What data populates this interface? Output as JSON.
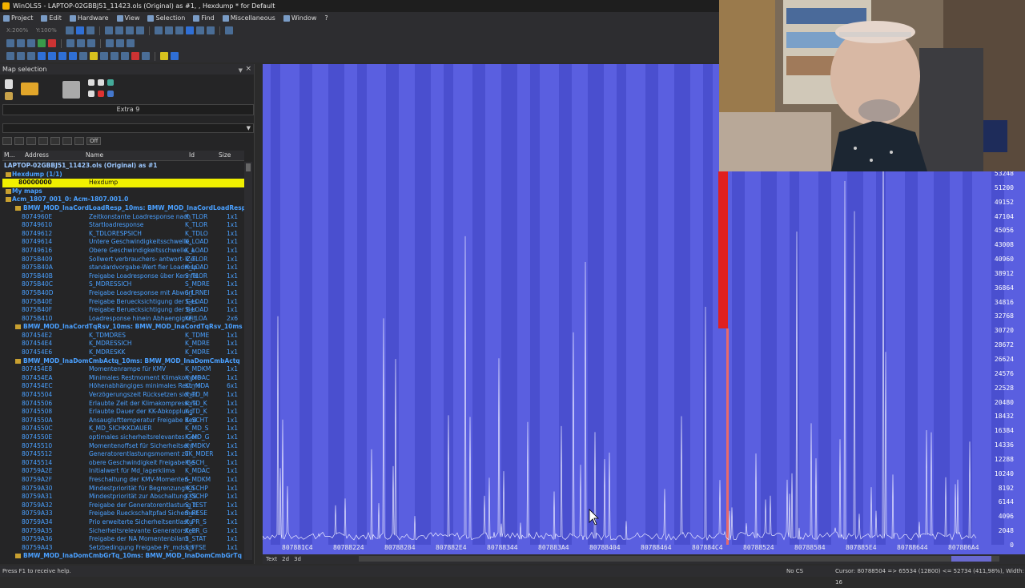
{
  "window": {
    "title": "WinOLS5 - LAPTOP-02GBBJ51_11423.ols (Original) as #1, , Hexdump * for Default"
  },
  "menu": [
    "Project",
    "Edit",
    "Hardware",
    "View",
    "Selection",
    "Find",
    "Miscellaneous",
    "Window",
    "?"
  ],
  "toolbar": {
    "zoom_x": "X:200%",
    "zoom_y": "Y:100%"
  },
  "map_selection": {
    "title": "Map selection",
    "extra_label": "Extra 9",
    "filter_off": "Off",
    "columns": [
      "M...",
      "Address",
      "Name",
      "Id",
      "Size"
    ],
    "project_row": "LAPTOP-02GBBJ51_11423.ols (Original) as #1",
    "hexdump_group": "Hexdump (1/1)",
    "hexdump_entry": {
      "address": "80000000",
      "name": "Hexdump"
    },
    "my_maps": "My maps",
    "acm_group": "Acm_1807_001_0: Acm-1807.001.0",
    "groups": [
      {
        "label": "BMW_MOD_InaCordLoadResp_10ms: BMW_MOD_InaCordLoadResp",
        "rows": [
          {
            "address": "8074960E",
            "name": "Zeitkonstante Loadresponse nach",
            "id": "K_TLOR",
            "size": "1x1"
          },
          {
            "address": "80749610",
            "name": "Startloadresponse",
            "id": "K_TLOR",
            "size": "1x1"
          },
          {
            "address": "80749612",
            "name": "K_TDLORESPSICH",
            "id": "K_TDLO",
            "size": "1x1"
          },
          {
            "address": "80749614",
            "name": "Untere Geschwindigkeitsschwelle,",
            "id": "K_LOAD",
            "size": "1x1"
          },
          {
            "address": "80749616",
            "name": "Obere Geschwindigkeitsschwelle, a",
            "id": "K_LOAD",
            "size": "1x1"
          },
          {
            "address": "8075B409",
            "name": "Sollwert verbrauchers- antwort- Zei",
            "id": "K_TLOR",
            "size": "1x1"
          },
          {
            "address": "8075B40A",
            "name": "standardvorgabe-Wert fier Loadresp",
            "id": "K_LOAD",
            "size": "1x1"
          },
          {
            "address": "8075B40B",
            "name": "Freigabe Loadresponse über Kennfel",
            "id": "S_TLOR",
            "size": "1x1"
          },
          {
            "address": "8075B40C",
            "name": "S_MDRESSICH",
            "id": "S_MDRE",
            "size": "1x1"
          },
          {
            "address": "8075B40D",
            "name": "Freigabe Loadresponse mit Abwurf",
            "id": "S_LRNEI",
            "size": "1x1"
          },
          {
            "address": "8075B40E",
            "name": "Freigabe Beruecksichtigung der Ges",
            "id": "S_LOAD",
            "size": "1x1"
          },
          {
            "address": "8075B40F",
            "name": "Freigabe Beruecksichtigung der Ber",
            "id": "S_LOAD",
            "size": "1x1"
          },
          {
            "address": "8075B410",
            "name": "Loadresponse hinein Abhaengigkeit",
            "id": "KF_LOA",
            "size": "2x6"
          }
        ]
      },
      {
        "label": "BMW_MOD_InaCordTqRsv_10ms: BMW_MOD_InaCordTqRsv_10ms",
        "rows": [
          {
            "address": "807454E2",
            "name": "K_TDMDRES",
            "id": "K_TDME",
            "size": "1x1"
          },
          {
            "address": "807454E4",
            "name": "K_MDRESSICH",
            "id": "K_MDRE",
            "size": "1x1"
          },
          {
            "address": "807454E6",
            "name": "K_MDRESKK",
            "id": "K_MDRE",
            "size": "1x1"
          }
        ]
      },
      {
        "label": "BMW_MOD_InaDomCmbActq_10ms: BMW_MOD_InaDomCmbActq",
        "rows": [
          {
            "address": "807454E8",
            "name": "Momentenrampe für KMV",
            "id": "K_MDKM",
            "size": "1x1"
          },
          {
            "address": "807454EA",
            "name": "Minimales Restmoment Klimakompre",
            "id": "K_MDAC",
            "size": "1x1"
          },
          {
            "address": "807454EC",
            "name": "Höhenabhängiges minimales Restmo",
            "id": "KL_MDA",
            "size": "6x1"
          },
          {
            "address": "80745504",
            "name": "Verzögerungszeit Rücksetzen sicher",
            "id": "K_TD_M",
            "size": "1x1"
          },
          {
            "address": "80745506",
            "name": "Erlaubte Zeit der Klimakompressora",
            "id": "K_TD_K",
            "size": "1x1"
          },
          {
            "address": "80745508",
            "name": "Erlaubte Dauer der KK-Abkopplung",
            "id": "K_TD_K",
            "size": "1x1"
          },
          {
            "address": "8074550A",
            "name": "Ansauglufttemperatur Freigabe Bed",
            "id": "K_SCHT",
            "size": "1x1"
          },
          {
            "address": "8074550C",
            "name": "K_MD_SICHKKDAUER",
            "id": "K_MD_S",
            "size": "1x1"
          },
          {
            "address": "8074550E",
            "name": "optimales sicherheitsrelevantes Gen",
            "id": "K_MD_G",
            "size": "1x1"
          },
          {
            "address": "80745510",
            "name": "Momentenoffset für Sicherheitsent",
            "id": "K_MDKV",
            "size": "1x1"
          },
          {
            "address": "80745512",
            "name": "Generatorentlastungsmoment zu",
            "id": "TK_MDER",
            "size": "1x1"
          },
          {
            "address": "80745514",
            "name": "obere Geschwindigkeit Freigabe Be",
            "id": "K_SCH_",
            "size": "1x1"
          },
          {
            "address": "80759A2E",
            "name": "Initialwert für Md_lagerklima",
            "id": "K_MDAC",
            "size": "1x1"
          },
          {
            "address": "80759A2F",
            "name": "Freschaltung der KMV-Momenten-",
            "id": "S_MDKM",
            "size": "1x1"
          },
          {
            "address": "80759A30",
            "name": "Mindestpriorität für Begrenzung Kli",
            "id": "K_SCHP",
            "size": "1x1"
          },
          {
            "address": "80759A31",
            "name": "Mindestpriorität zur Abschaltung Kli",
            "id": "K_SCHP",
            "size": "1x1"
          },
          {
            "address": "80759A32",
            "name": "Freigabe der Generatorentlastung z",
            "id": "S_TEST",
            "size": "1x1"
          },
          {
            "address": "80759A33",
            "name": "Freigabe Rueckschaltpfad Sicherheit",
            "id": "S_RESE",
            "size": "1x1"
          },
          {
            "address": "80759A34",
            "name": "Prio erweiterte Sicherheitsentlastu",
            "id": "K_PR_S",
            "size": "1x1"
          },
          {
            "address": "80759A35",
            "name": "Sicherheitsrelevante Generatorsteu",
            "id": "K_PR_G",
            "size": "1x1"
          },
          {
            "address": "80759A36",
            "name": "Freigabe der NA Momentenbilanz",
            "id": "S_STAT",
            "size": "1x1"
          },
          {
            "address": "80759A43",
            "name": "Setzbedingung Freigabe Pr_mdsich",
            "id": "S_FFSE",
            "size": "1x1"
          }
        ]
      }
    ],
    "last_group": "BMW_MOD_InaDomCmbGrTq_10ms: BMW_MOD_InaDomCmbGrTq"
  },
  "graph": {
    "y_ticks": [
      "53248",
      "51200",
      "49152",
      "47104",
      "45056",
      "43008",
      "40960",
      "38912",
      "36864",
      "34816",
      "32768",
      "30720",
      "28672",
      "26624",
      "24576",
      "22528",
      "20480",
      "18432",
      "16384",
      "14336",
      "12288",
      "10240",
      "8192",
      "6144",
      "4096",
      "2048",
      "0"
    ],
    "x_ticks": [
      "807881C4",
      "80788224",
      "80788284",
      "807882E4",
      "80788344",
      "807883A4",
      "80788404",
      "80788464",
      "807884C4",
      "80788524",
      "80788584",
      "807885E4",
      "80788644",
      "807886A4"
    ],
    "bottom_tabs": [
      "Text",
      "2d",
      "3d"
    ]
  },
  "status": {
    "help": "Press F1 to receive help.",
    "cs": "No CS",
    "cursor": "Cursor: 80788504 => 65534 (12800) <= 52734 (411,98%), Width: 16"
  },
  "colors": {
    "graph_bg": "#5a5fe0",
    "graph_band": "#4a4fcf",
    "highlight_red": "#e02020",
    "selected_row": "#f0f000",
    "link_blue": "#4aa0ff"
  }
}
